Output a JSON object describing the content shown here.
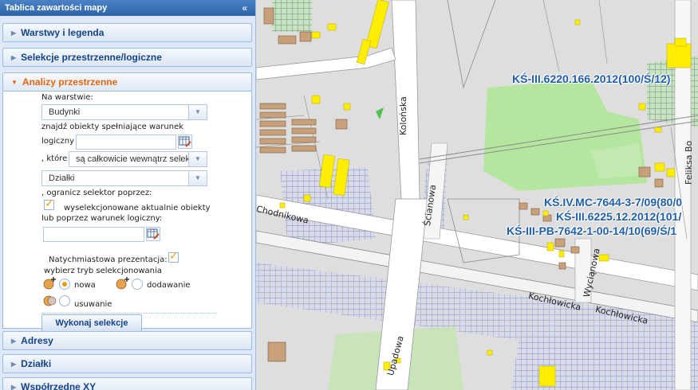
{
  "panel": {
    "title": "Tablica zawartości mapy",
    "collapse_icon": "double-chevron-up-icon",
    "sections": {
      "layers": "Warstwy i legenda",
      "selections": "Selekcje przestrzenne/logiczne",
      "analysis": "Analizy przestrzenne",
      "addresses": "Adresy",
      "parcels": "Działki",
      "coordinates": "Współrzędne XY"
    }
  },
  "analysis": {
    "on_layer_label": "Na warstwie:",
    "layer_value": "Budynki",
    "find_label": "znajdź obiekty spełniające warunek",
    "logical_label": "logiczny",
    "which_label": ", które",
    "relation_value": "są całkowicie wewnątrz selek",
    "target_layer_value": "Działki",
    "limit_label": ", ogranicz selektor poprzez:",
    "selected_objects_label": "wyselekcjonowane aktualnie obiekty",
    "or_condition_label": "lub poprzez warunek logiczny:",
    "instant_label": "Natychmiastowa prezentacja:",
    "mode_label": "wybierz tryb selekcjonowania",
    "mode_new": "nowa",
    "mode_add": "dodawanie",
    "mode_remove": "usuwanie",
    "execute_label": "Wykonaj selekcje",
    "selected_objects_checked": true,
    "instant_checked": true,
    "selected_mode": "nowa"
  },
  "map": {
    "streets": {
      "kolonska": "Kolońska",
      "scianowa": "Ścianowa",
      "chodnikowa": "Chodnikowa",
      "upadowa": "Upadowa",
      "kochlowicka1": "Kochłowicka",
      "kochlowicka2": "Kochłowicka",
      "wycianowa": "Wyciąnowa",
      "feliksa": "Feliksa Bo"
    },
    "parcel_labels": {
      "p1": "KŚ-III.6220.166.2012(100/Ś/12)",
      "p2": "KŚ.IV.MC-7644-3-7/09(80/0",
      "p3": "KŚ-III.6225.12.2012(101/",
      "p4": "KŚ-III-PB-7642-1-00-14/10(69/Ś/1"
    },
    "colors": {
      "buildings": "#ffee00",
      "green": "#b5e6a0",
      "hatch": "#8080ff",
      "label": "#1f5fa8",
      "roads": "#ffffff"
    }
  }
}
